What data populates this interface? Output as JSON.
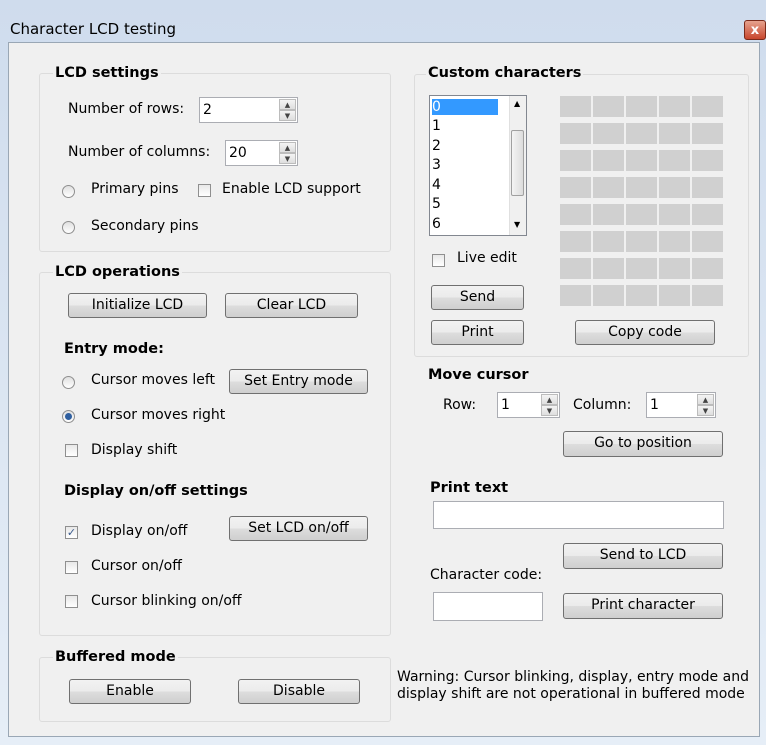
{
  "window": {
    "title": "Character LCD testing",
    "close_glyph": "x"
  },
  "lcd_settings": {
    "title": "LCD settings",
    "rows_label": "Number of rows:",
    "rows_value": "2",
    "cols_label": "Number of columns:",
    "cols_value": "20",
    "primary_pins": "Primary pins",
    "secondary_pins": "Secondary pins",
    "enable_lcd_support": "Enable LCD support"
  },
  "lcd_operations": {
    "title": "LCD operations",
    "initialize": "Initialize LCD",
    "clear": "Clear LCD",
    "entry_mode_title": "Entry mode:",
    "cursor_left": "Cursor moves left",
    "cursor_right": "Cursor moves right",
    "set_entry_mode": "Set Entry mode",
    "display_shift": "Display shift",
    "display_onoff_title": "Display on/off settings",
    "display_onoff": "Display on/off",
    "set_lcd_onoff": "Set LCD on/off",
    "cursor_onoff": "Cursor on/off",
    "cursor_blinking": "Cursor blinking on/off"
  },
  "buffered_mode": {
    "title": "Buffered mode",
    "enable": "Enable",
    "disable": "Disable",
    "warning_line1": "Warning: Cursor blinking, display, entry mode and",
    "warning_line2": "display shift are not operational in buffered mode"
  },
  "custom_characters": {
    "title": "Custom characters",
    "items": [
      "0",
      "1",
      "2",
      "3",
      "4",
      "5",
      "6"
    ],
    "selected": "0",
    "live_edit": "Live edit",
    "send": "Send",
    "print": "Print",
    "copy_code": "Copy code"
  },
  "move_cursor": {
    "title": "Move cursor",
    "row_label": "Row:",
    "row_value": "1",
    "col_label": "Column:",
    "col_value": "1",
    "go": "Go to position"
  },
  "print_text": {
    "title": "Print text",
    "text_value": "",
    "send_to_lcd": "Send to LCD",
    "char_code_label": "Character code:",
    "char_code_value": "",
    "print_character": "Print character"
  },
  "colors": {
    "selection": "#3399ff",
    "pixel_off": "#d0d0d0",
    "close_button": "#c8462d"
  },
  "icons": {
    "scroll_up": "▲",
    "scroll_down": "▼",
    "spin_up": "▲",
    "spin_down": "▼",
    "check": "✓"
  }
}
